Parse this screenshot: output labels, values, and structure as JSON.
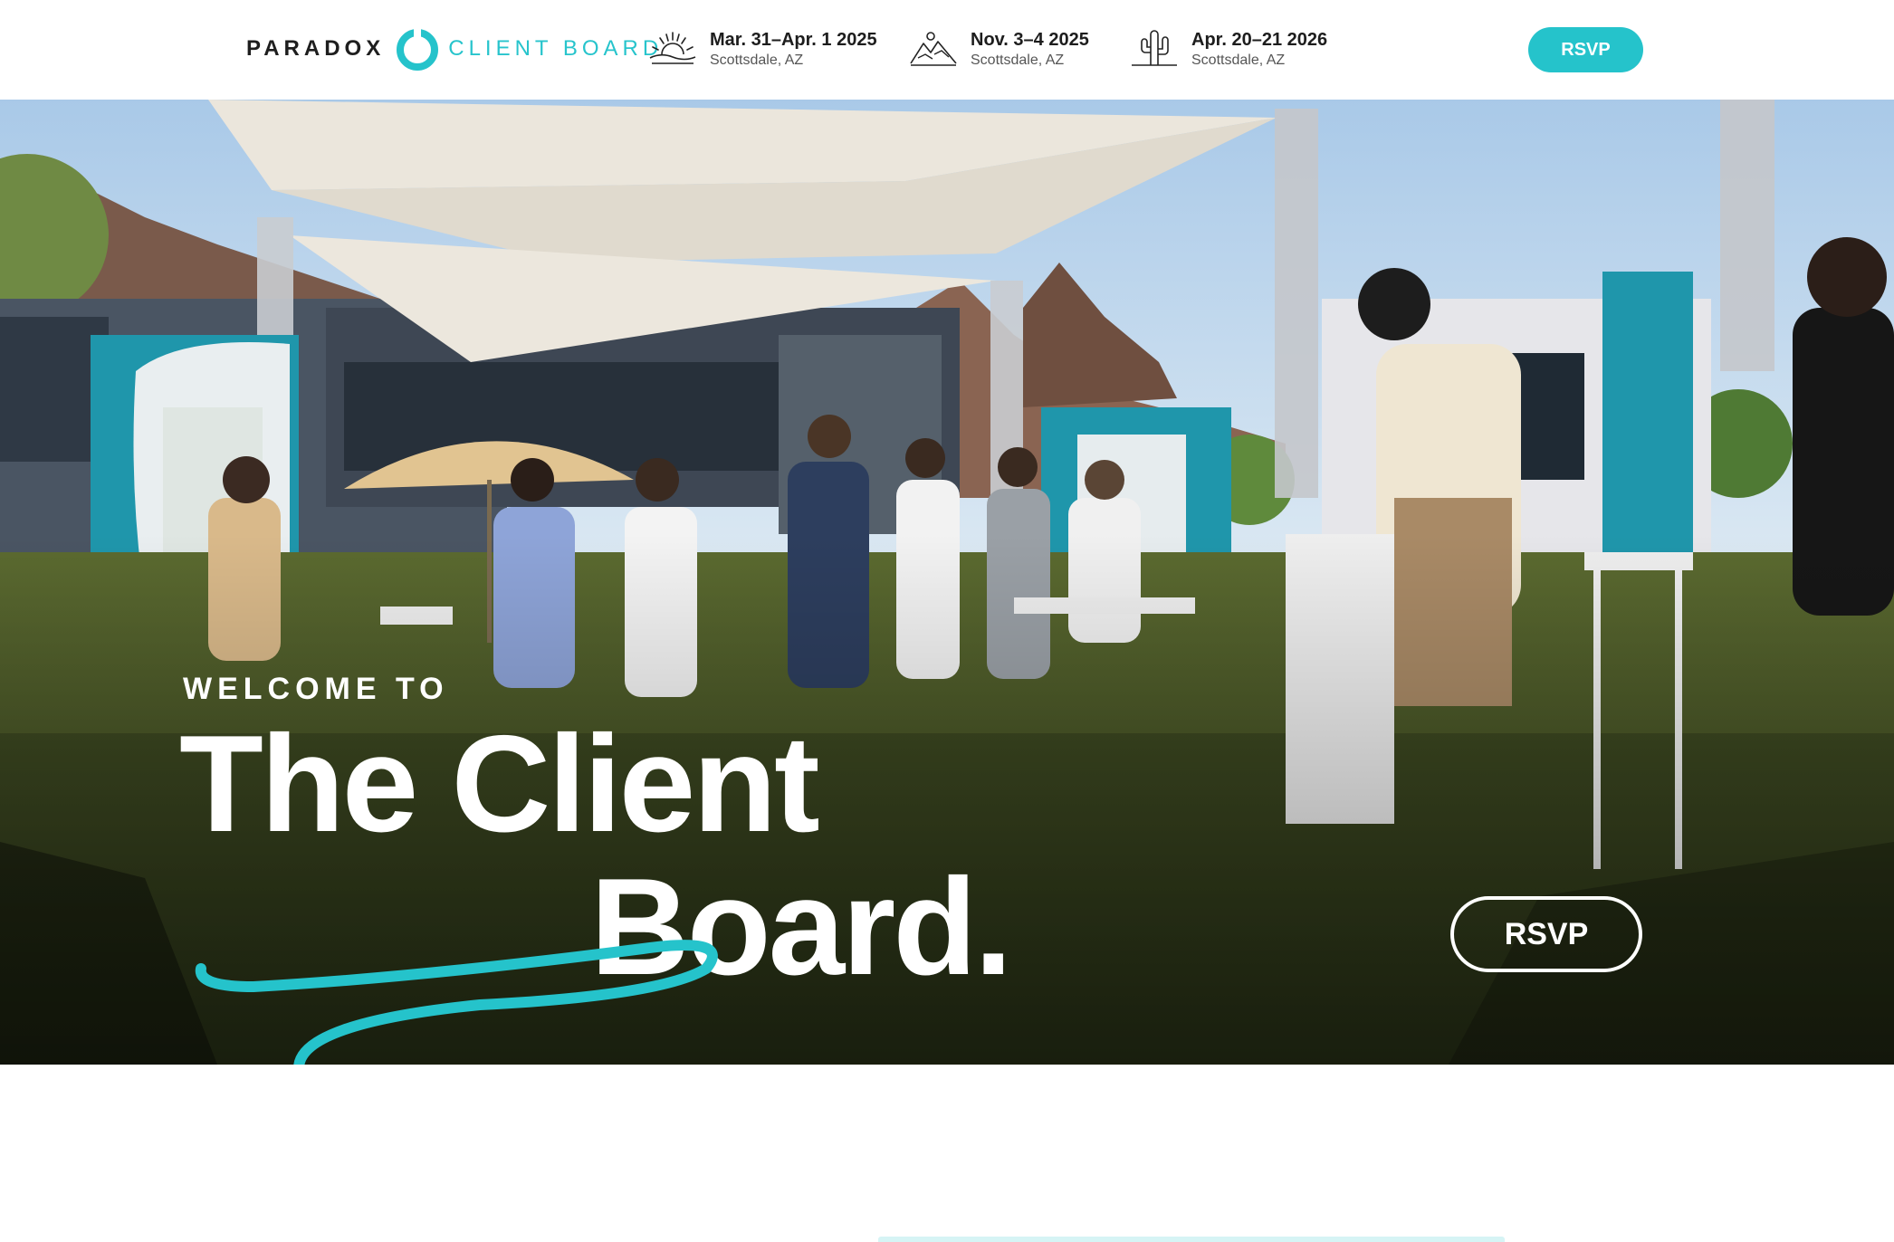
{
  "header": {
    "logo": {
      "left_text": "PARADOX",
      "right_text": "CLIENT BOARD"
    },
    "events": [
      {
        "date": "Mar. 31–Apr. 1 2025",
        "place": "Scottsdale, AZ",
        "icon": "sunrise-icon"
      },
      {
        "date": "Nov. 3–4 2025",
        "place": "Scottsdale, AZ",
        "icon": "mountain-icon"
      },
      {
        "date": "Apr. 20–21 2026",
        "place": "Scottsdale, AZ",
        "icon": "cactus-icon"
      }
    ],
    "rsvp_label": "RSVP"
  },
  "hero": {
    "eyebrow": "WELCOME TO",
    "title_line1": "The Client",
    "title_line2": "Board.",
    "rsvp_label": "RSVP"
  },
  "colors": {
    "brand_teal": "#25c3cb",
    "text_dark": "#1d1d1d",
    "white": "#ffffff"
  }
}
